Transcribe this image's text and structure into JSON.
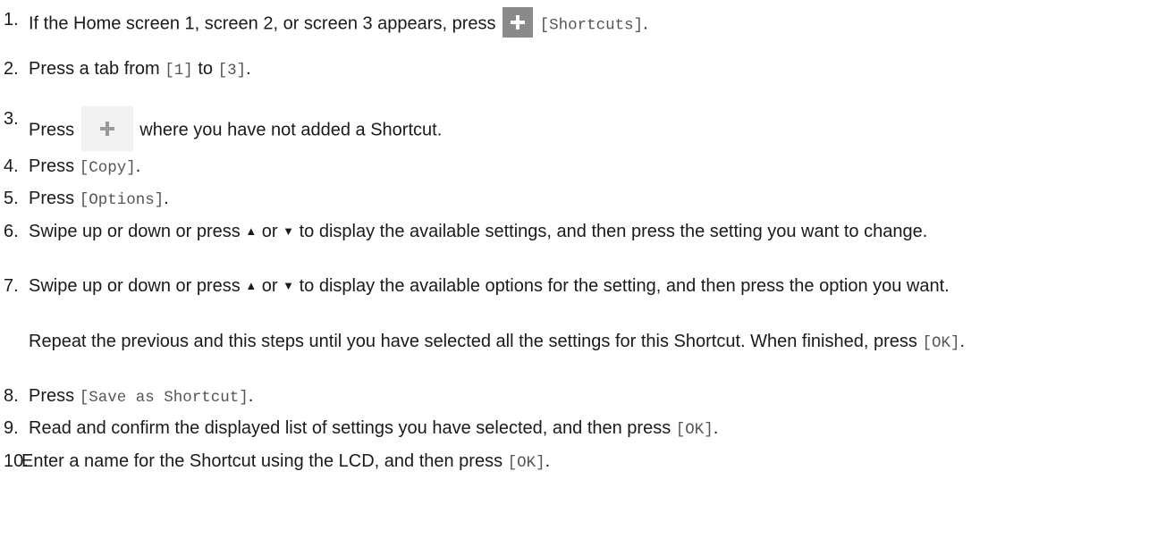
{
  "steps": [
    {
      "num": "1.",
      "t1": "If the Home screen 1, screen 2, or screen 3 appears, press",
      "code1": "[Shortcuts]",
      "t2": "."
    },
    {
      "num": "2.",
      "t1": "Press a tab from",
      "code1": "[1]",
      "t2": "to",
      "code2": "[3]",
      "t3": "."
    },
    {
      "num": "3.",
      "t1": "Press",
      "t2": "where you have not added a Shortcut."
    },
    {
      "num": "4.",
      "t1": "Press",
      "code1": "[Copy]",
      "t2": "."
    },
    {
      "num": "5.",
      "t1": "Press",
      "code1": "[Options]",
      "t2": "."
    },
    {
      "num": "6.",
      "t1": "Swipe up or down or press",
      "up": "▲",
      "t2": "or",
      "down": "▼",
      "t3": "to display the available settings, and then press the setting you want to change."
    },
    {
      "num": "7.",
      "t1": "Swipe up or down or press",
      "up": "▲",
      "t2": "or",
      "down": "▼",
      "t3": "to display the available options for the setting, and then press the option you want."
    },
    {
      "num": "8.",
      "t1": "Press",
      "code1": "[Save as Shortcut]",
      "t2": "."
    },
    {
      "num": "9.",
      "t1": "Read and confirm the displayed list of settings you have selected, and then press",
      "code1": "[OK]",
      "t2": "."
    },
    {
      "num": "10.",
      "t1": "Enter a name for the Shortcut using the LCD, and then press",
      "code1": "[OK]",
      "t2": "."
    }
  ],
  "note": {
    "t1": "Repeat the previous and this steps until you have selected all the settings for this Shortcut. When finished, press",
    "code1": "[OK]",
    "t2": "."
  },
  "icons": {
    "plus_dark_color": "#8a8a8a",
    "plus_light_color": "#9a9a9a"
  }
}
